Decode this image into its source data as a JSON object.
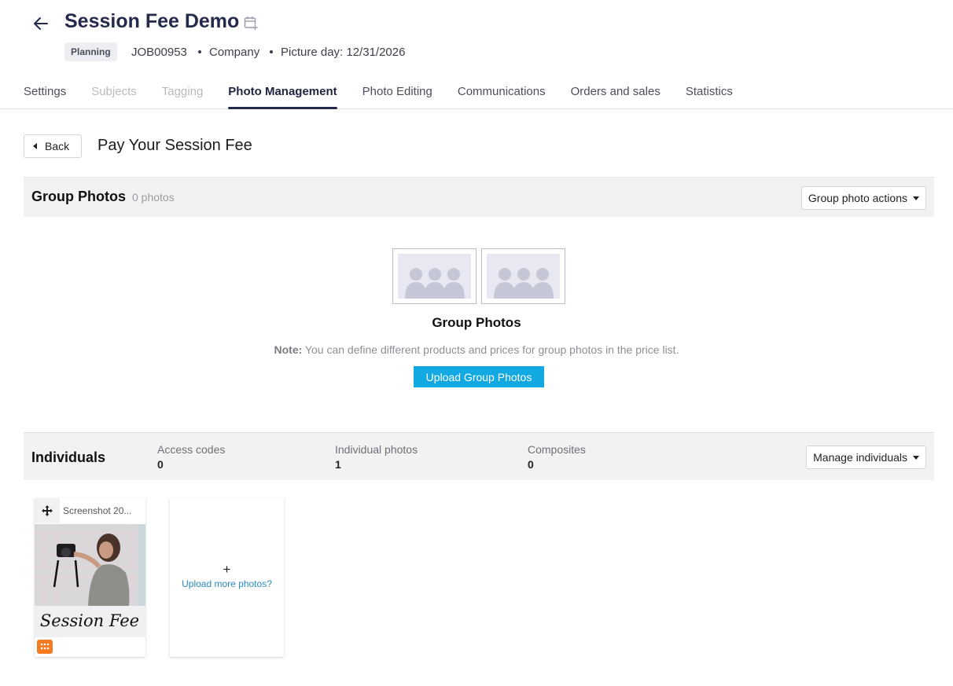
{
  "header": {
    "title": "Session Fee Demo",
    "status": "Planning",
    "job_id": "JOB00953",
    "company": "Company",
    "picture_day": "Picture day: 12/31/2026",
    "icons": {
      "back": "arrow-left-icon",
      "calendar": "calendar-add-icon"
    }
  },
  "tabs": [
    {
      "label": "Settings",
      "state": "normal"
    },
    {
      "label": "Subjects",
      "state": "disabled"
    },
    {
      "label": "Tagging",
      "state": "disabled"
    },
    {
      "label": "Photo Management",
      "state": "active"
    },
    {
      "label": "Photo Editing",
      "state": "normal"
    },
    {
      "label": "Communications",
      "state": "normal"
    },
    {
      "label": "Orders and sales",
      "state": "normal"
    },
    {
      "label": "Statistics",
      "state": "normal"
    }
  ],
  "page": {
    "back_label": "Back",
    "heading": "Pay Your Session Fee"
  },
  "group_photos": {
    "title": "Group Photos",
    "count": "0 photos",
    "actions_label": "Group photo actions",
    "empty_title": "Group Photos",
    "note_label": "Note:",
    "note_text": " You can define different products and prices for group photos in the price list.",
    "upload_label": "Upload Group Photos"
  },
  "individuals": {
    "title": "Individuals",
    "stats": [
      {
        "label": "Access codes",
        "value": "0"
      },
      {
        "label": "Individual photos",
        "value": "1"
      },
      {
        "label": "Composites",
        "value": "0"
      }
    ],
    "manage_label": "Manage individuals",
    "photos": [
      {
        "filename": "Screenshot 20...",
        "overlay_text": "Session Fee"
      }
    ],
    "upload_more_plus": "+",
    "upload_more_label": "Upload more photos?"
  },
  "colors": {
    "accent": "#12a9e3",
    "title": "#232a4a",
    "link": "#2a8bc4",
    "badge": "#f47b20"
  }
}
